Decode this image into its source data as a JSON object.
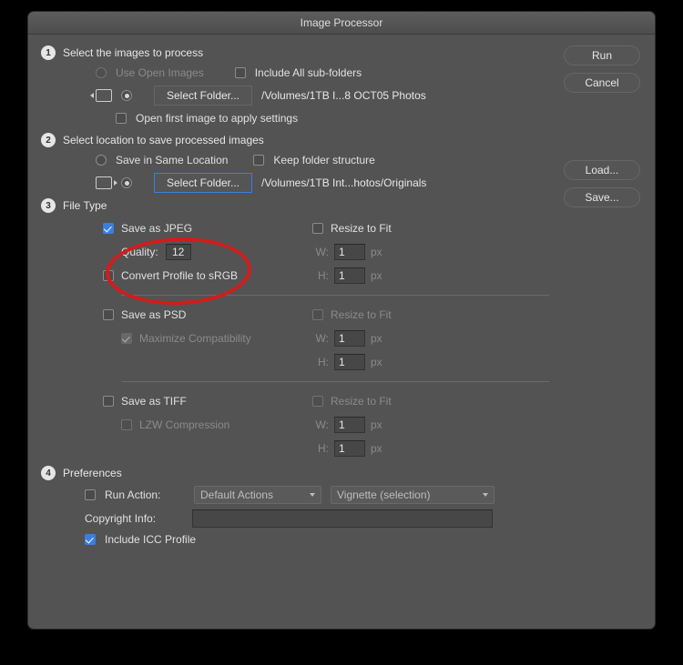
{
  "window": {
    "title": "Image Processor"
  },
  "buttons": {
    "run": "Run",
    "cancel": "Cancel",
    "load": "Load...",
    "save": "Save...",
    "select_folder": "Select Folder..."
  },
  "section1": {
    "title": "Select the images to process",
    "use_open_images": "Use Open Images",
    "include_subfolders": "Include All sub-folders",
    "source_path": "/Volumes/1TB I...8 OCT05 Photos",
    "open_first_image": "Open first image to apply settings"
  },
  "section2": {
    "title": "Select location to save processed images",
    "save_same_location": "Save in Same Location",
    "keep_folder_structure": "Keep folder structure",
    "dest_path": "/Volumes/1TB Int...hotos/Originals"
  },
  "section3": {
    "title": "File Type",
    "jpeg": {
      "label": "Save as JPEG",
      "quality_label": "Quality:",
      "quality_value": "12",
      "convert_srgb": "Convert Profile to sRGB",
      "resize_label": "Resize to Fit",
      "w_label": "W:",
      "w_value": "1",
      "h_label": "H:",
      "h_value": "1",
      "px": "px"
    },
    "psd": {
      "label": "Save as PSD",
      "max_compat": "Maximize Compatibility",
      "resize_label": "Resize to Fit",
      "w_label": "W:",
      "w_value": "1",
      "h_label": "H:",
      "h_value": "1",
      "px": "px"
    },
    "tiff": {
      "label": "Save as TIFF",
      "lzw": "LZW Compression",
      "resize_label": "Resize to Fit",
      "w_label": "W:",
      "w_value": "1",
      "h_label": "H:",
      "h_value": "1",
      "px": "px"
    }
  },
  "section4": {
    "title": "Preferences",
    "run_action": "Run Action:",
    "action_set": "Default Actions",
    "action_name": "Vignette (selection)",
    "copyright_label": "Copyright Info:",
    "copyright_value": "",
    "include_icc": "Include ICC Profile"
  }
}
